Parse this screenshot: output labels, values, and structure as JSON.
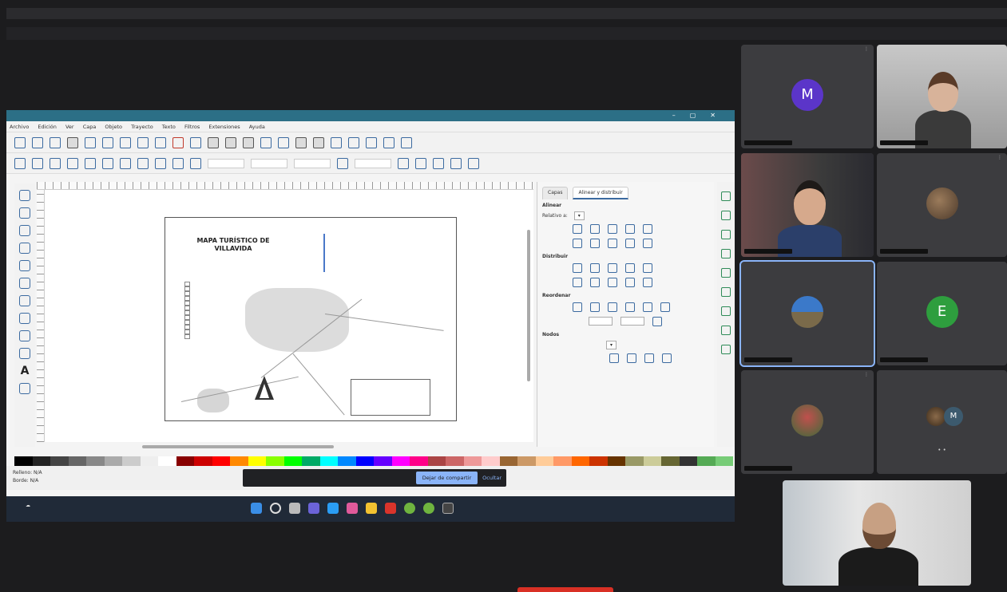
{
  "meeting": {
    "top_bar_text": "",
    "share_note": ""
  },
  "inkscape": {
    "title": "",
    "menu": [
      "Archivo",
      "Edición",
      "Ver",
      "Capa",
      "Objeto",
      "Trayecto",
      "Texto",
      "Filtros",
      "Extensiones",
      "Ayuda"
    ],
    "map": {
      "title_line1": "MAPA TURÍSTICO DE",
      "title_line2": "VILLAVIDA"
    },
    "dock": {
      "tab_layers": "Capas",
      "tab_align": "Alinear y distribuir",
      "section_align": "Alinear",
      "relative_to": "Relativo a:",
      "relative_value": "",
      "section_distribute": "Distribuir",
      "section_rearrange": "Reordenar",
      "section_nodes": "Nodos"
    },
    "status": {
      "fill_label": "Relleno:",
      "fill_value": "N/A",
      "stroke_label": "Borde:",
      "stroke_value": "N/A"
    }
  },
  "share_banner": {
    "message": "",
    "stop_label": "Dejar de compartir",
    "hide_label": "Ocultar"
  },
  "participants": [
    {
      "kind": "avatar",
      "initial": "M",
      "color": "#5b35c9"
    },
    {
      "kind": "video"
    },
    {
      "kind": "video"
    },
    {
      "kind": "photo"
    },
    {
      "kind": "photo"
    },
    {
      "kind": "avatar",
      "initial": "E",
      "color": "#2e9e3e"
    },
    {
      "kind": "photo"
    },
    {
      "kind": "group",
      "initial": "M",
      "color": "#3c5a6e"
    }
  ],
  "colors": {
    "inkscape_titlebar": "#2c6f86",
    "taskbar": "#202a38",
    "meet_blue": "#8ab4f8",
    "leave_red": "#d93025"
  }
}
